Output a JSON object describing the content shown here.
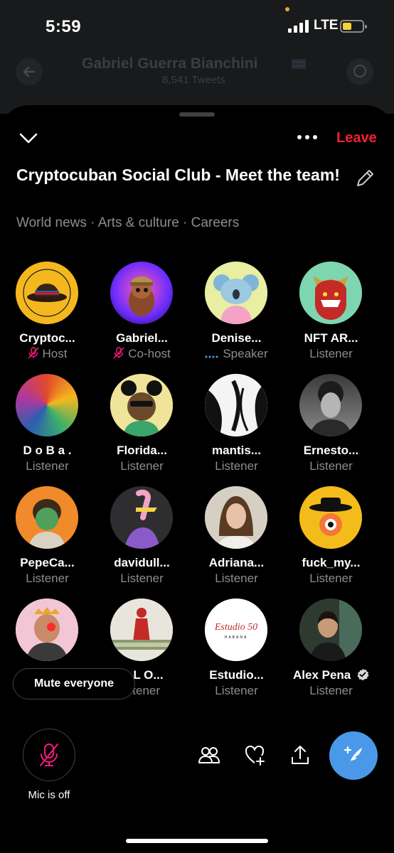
{
  "status_bar": {
    "time": "5:59",
    "network": "LTE",
    "battery_level": 0.45
  },
  "profile": {
    "name": "Gabriel Guerra Bianchini",
    "subtitle": "8,541 Tweets"
  },
  "space": {
    "leave_label": "Leave",
    "title": "Cryptocuban Social Club - Meet the team!",
    "topics": "World news · Arts & culture · Careers"
  },
  "participants": [
    {
      "name": "Cryptoc...",
      "role": "Host",
      "role_icon": "mic-off-icon"
    },
    {
      "name": "Gabriel...",
      "role": "Co-host",
      "role_icon": "mic-off-icon"
    },
    {
      "name": "Denise...",
      "role": "Speaker",
      "role_icon": "speaking-dots-icon"
    },
    {
      "name": "NFT AR...",
      "role": "Listener"
    },
    {
      "name": "D o B a .",
      "role": "Listener"
    },
    {
      "name": "Florida...",
      "role": "Listener"
    },
    {
      "name": "mantis...",
      "role": "Listener"
    },
    {
      "name": "Ernesto...",
      "role": "Listener"
    },
    {
      "name": "PepeCa...",
      "role": "Listener"
    },
    {
      "name": "davidull...",
      "role": "Listener"
    },
    {
      "name": "Adriana...",
      "role": "Listener"
    },
    {
      "name": "fuck_my...",
      "role": "Listener"
    },
    {
      "name": "",
      "role": ""
    },
    {
      "name": "O L O...",
      "role": "istener"
    },
    {
      "name": "Estudio...",
      "role": "Listener"
    },
    {
      "name": "Alex Pena",
      "role": "Listener",
      "verified": true
    }
  ],
  "avatar_text": {
    "host_ring": "CRYPTOCUBAN SOCIAL CLUB",
    "studio_logo": "Estudio 50",
    "studio_sub": "HABANA"
  },
  "mute_everyone_label": "Mute everyone",
  "mic_status": "Mic is off",
  "colors": {
    "accent_blue": "#4a99e9",
    "leave_red": "#f4212e",
    "host_pink": "#f91880",
    "secondary_text": "#8a8d91"
  }
}
